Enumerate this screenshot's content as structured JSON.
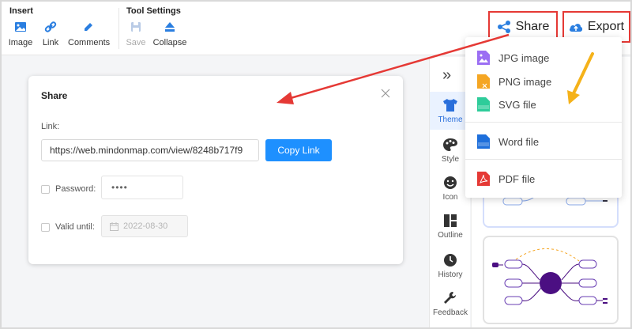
{
  "toolbar": {
    "insert_title": "Insert",
    "tool_settings_title": "Tool Settings",
    "image_label": "Image",
    "link_label": "Link",
    "comments_label": "Comments",
    "save_label": "Save",
    "collapse_label": "Collapse",
    "share_label": "Share",
    "export_label": "Export"
  },
  "share_dialog": {
    "title": "Share",
    "link_label": "Link:",
    "link_value": "https://web.mindonmap.com/view/8248b717f9",
    "copy_button": "Copy Link",
    "password_label": "Password:",
    "password_value": "••••",
    "valid_until_label": "Valid until:",
    "valid_until_value": "2022-08-30"
  },
  "export_menu": {
    "items": [
      {
        "label": "JPG image",
        "icon": "jpg-file-icon",
        "color": "#9b6ef3"
      },
      {
        "label": "PNG image",
        "icon": "png-file-icon",
        "color": "#f5a623"
      },
      {
        "label": "SVG file",
        "icon": "svg-file-icon",
        "color": "#2ecc9a"
      },
      {
        "label": "Word file",
        "icon": "doc-file-icon",
        "color": "#1e6fdb"
      },
      {
        "label": "PDF file",
        "icon": "pdf-file-icon",
        "color": "#e53935"
      }
    ]
  },
  "right_sidebar": {
    "items": [
      {
        "label": "Theme",
        "icon": "tshirt-icon",
        "active": true
      },
      {
        "label": "Style",
        "icon": "palette-icon"
      },
      {
        "label": "Icon",
        "icon": "smiley-icon"
      },
      {
        "label": "Outline",
        "icon": "outline-icon"
      },
      {
        "label": "History",
        "icon": "clock-icon"
      },
      {
        "label": "Feedback",
        "icon": "wrench-icon"
      }
    ]
  },
  "colors": {
    "accent": "#1e90ff",
    "highlight_box": "#e53935",
    "arrow_red": "#e53935",
    "arrow_yellow": "#f5b21a",
    "theme_purple": "#4b0f82"
  }
}
